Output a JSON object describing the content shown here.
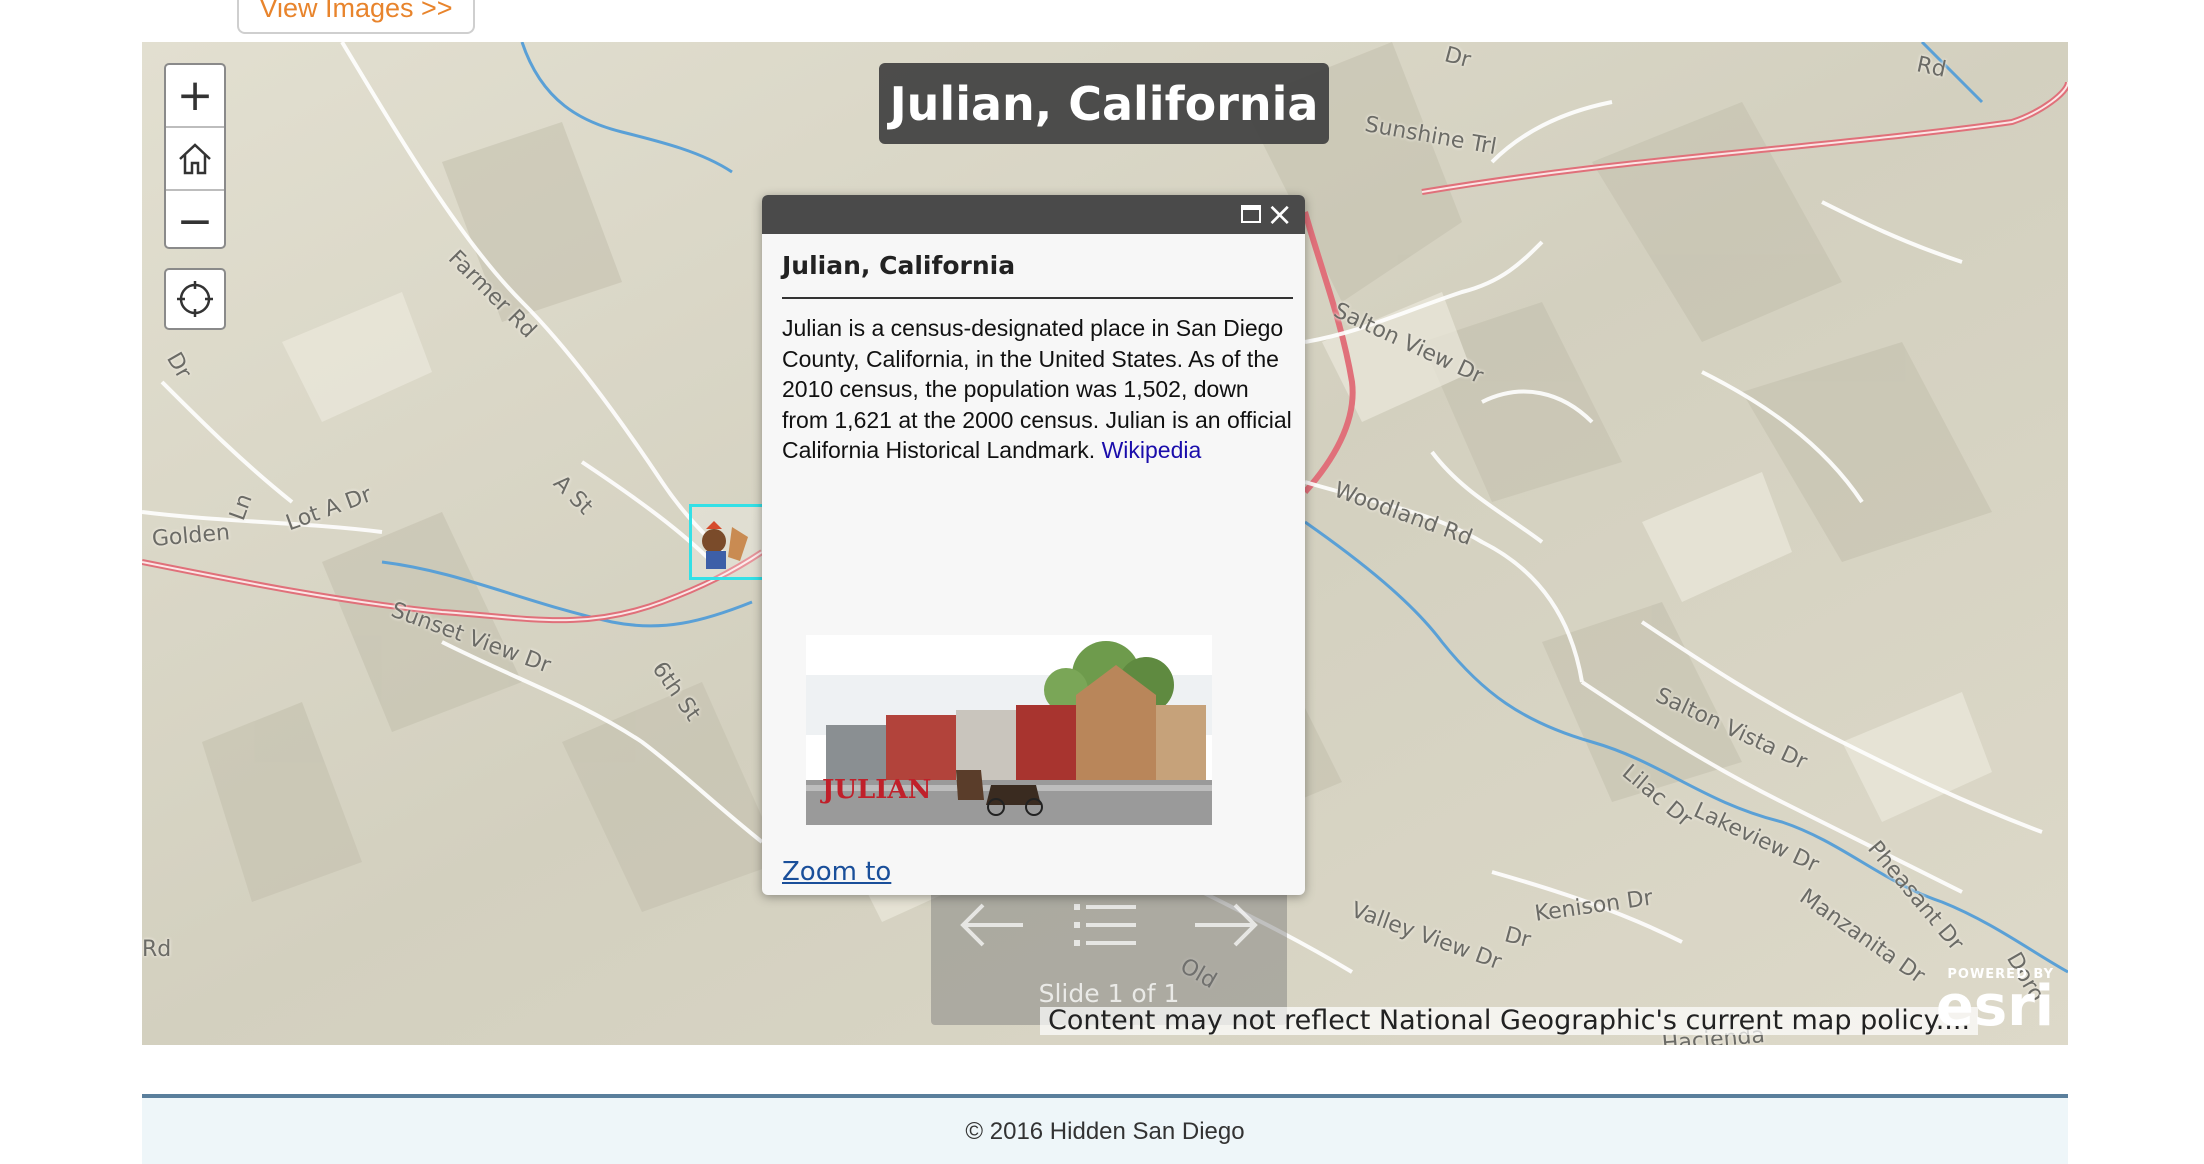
{
  "header": {
    "view_images_label": "View Images >>"
  },
  "map": {
    "title": "Julian, California",
    "controls": {
      "zoom_in": "+",
      "zoom_out": "−"
    },
    "road_labels": [
      "Sunshine Trl",
      "Farmer Rd",
      "Salton View Dr",
      "Woodland Rd",
      "A St",
      "Lot A Dr",
      "Golden",
      "Ln",
      "Sunset View Dr",
      "6th St",
      "Salton Vista Dr",
      "Lilac Dr",
      "Lakeview Dr",
      "Pheasant Dr",
      "Manzanita Dr",
      "Valley View Dr",
      "Kenison Dr",
      "Old",
      "Dr",
      "Rd",
      "Rd",
      "Dr",
      "Dr",
      "Doro",
      "Hacienda"
    ],
    "attribution": "Content may not reflect National Geographic's current map policy....",
    "esri": {
      "powered": "POWERED BY",
      "brand": "esri"
    },
    "colors": {
      "water": "#5aa0d6",
      "highway": "#e0707a",
      "road": "#ffffff",
      "terrain": "#d9d6c6"
    }
  },
  "popup": {
    "title": "Julian, California",
    "description": "Julian is a census-designated place in San Diego County, California, in the United States. As of the 2010 census, the population was 1,502, down from 1,621 at the 2000 census. Julian is an official California Historical Landmark.",
    "link_label": "Wikipedia",
    "zoom_to_label": "Zoom to",
    "image_caption": "JULIAN"
  },
  "slides": {
    "label": "Slide 1 of 1"
  },
  "footer": {
    "copyright": "© 2016 Hidden San Diego"
  }
}
